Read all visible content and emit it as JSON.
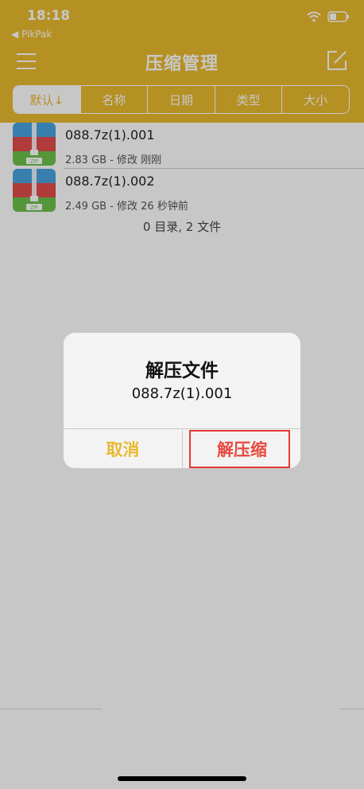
{
  "status_bar": {
    "time": "18:18",
    "back_app": "◀ PikPak"
  },
  "nav": {
    "title": "压缩管理"
  },
  "sort_tabs": [
    {
      "label": "默认↓",
      "active": true
    },
    {
      "label": "名称",
      "active": false
    },
    {
      "label": "日期",
      "active": false
    },
    {
      "label": "类型",
      "active": false
    },
    {
      "label": "大小",
      "active": false
    }
  ],
  "files": [
    {
      "name": "088.7z(1).001",
      "meta": "2.83 GB - 修改 刚刚"
    },
    {
      "name": "088.7z(1).002",
      "meta": "2.49 GB - 修改 26 秒钟前"
    }
  ],
  "summary": "0 目录, 2 文件",
  "alert": {
    "title": "解压文件",
    "message": "088.7z(1).001",
    "cancel": "取消",
    "confirm": "解压缩"
  },
  "colors": {
    "accent": "#e8b92e",
    "confirm": "#e84a3f",
    "highlight": "#e53935"
  },
  "icons": [
    "menu-icon",
    "edit-icon",
    "zip-file-icon",
    "wifi-icon",
    "battery-icon"
  ]
}
